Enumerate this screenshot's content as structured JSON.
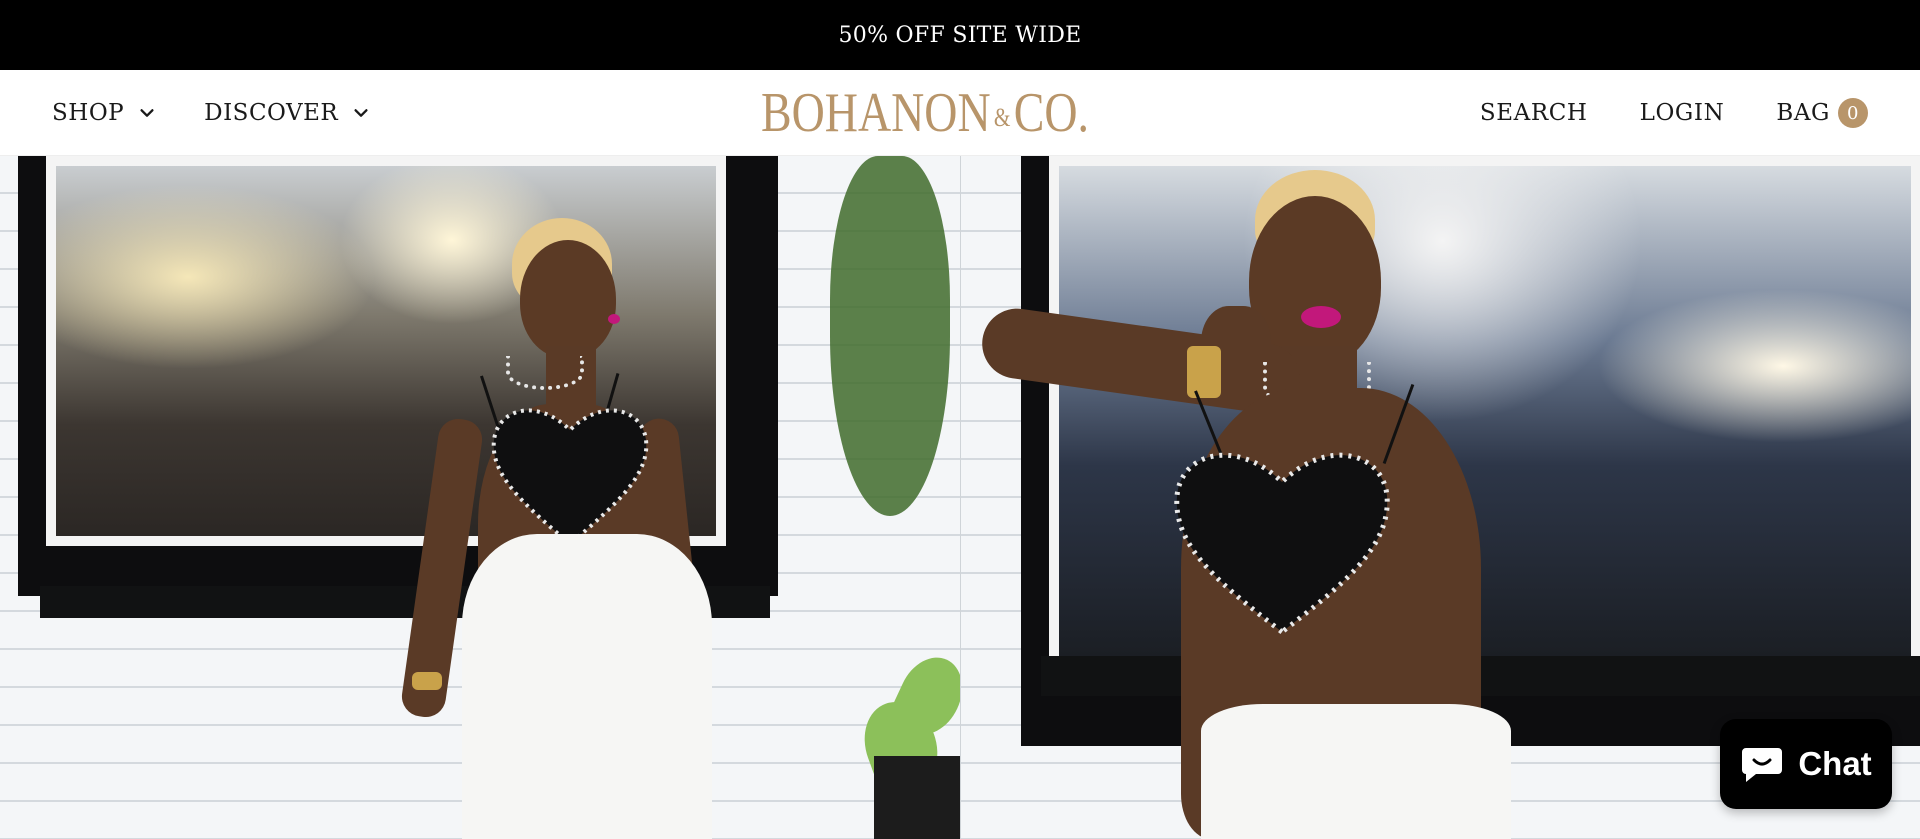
{
  "theme": {
    "brand": "#b8956a",
    "announce_bg": "#000000"
  },
  "announcement": {
    "text": "50% OFF SITE WIDE"
  },
  "nav": {
    "left": [
      {
        "label": "SHOP",
        "icon": "chevron-down-icon"
      },
      {
        "label": "DISCOVER",
        "icon": "chevron-down-icon"
      }
    ],
    "logo": {
      "main_left": "BOHANON",
      "amp": "&",
      "main_right": "CO."
    },
    "right": {
      "search": "SEARCH",
      "login": "LOGIN",
      "bag": "BAG",
      "bag_count": "0"
    }
  },
  "hero": {
    "panels": [
      {
        "alt_subject": "model-in-heart-crop-top-left"
      },
      {
        "alt_subject": "model-in-heart-crop-top-right"
      }
    ]
  },
  "chat": {
    "label": "Chat",
    "icon": "chat-bubble-icon"
  }
}
